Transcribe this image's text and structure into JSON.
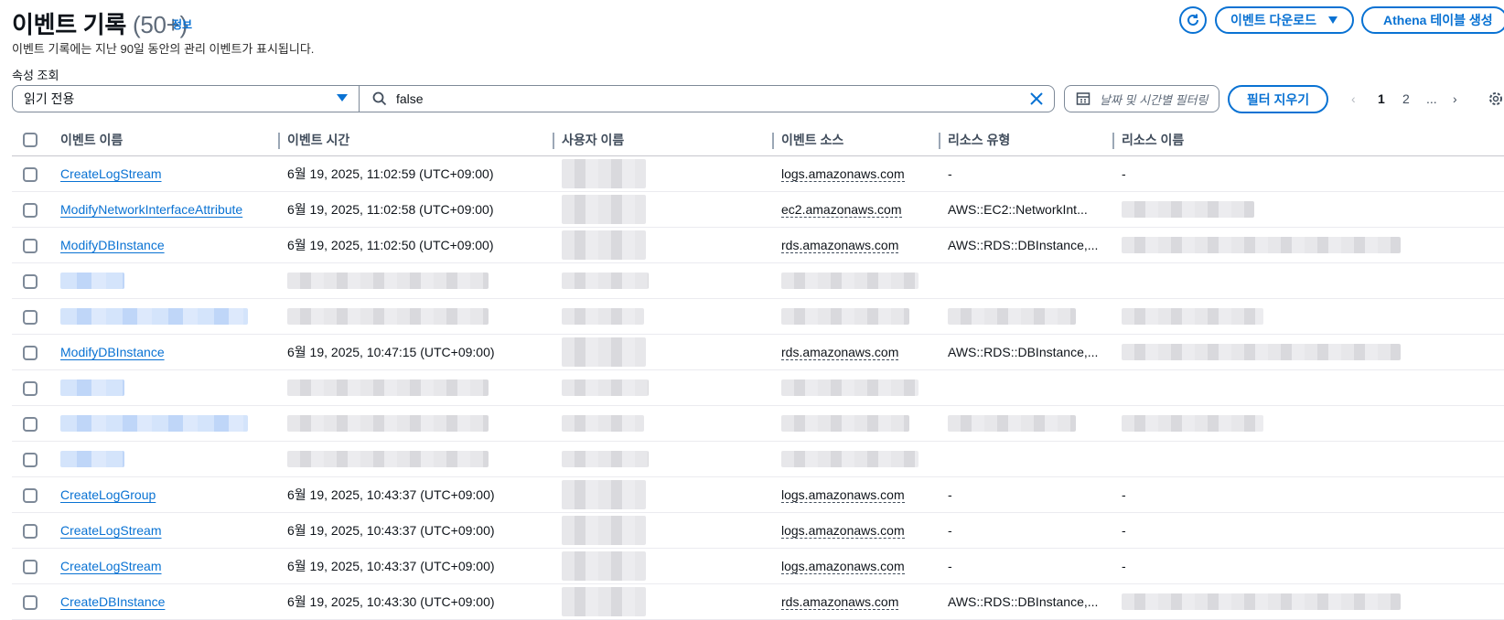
{
  "header": {
    "title": "이벤트 기록",
    "count": "(50+)",
    "info_link": "정보",
    "subtitle": "이벤트 기록에는 지난 90일 동안의 관리 이벤트가 표시됩니다."
  },
  "actions": {
    "refresh_icon": "refresh-icon",
    "download_label": "이벤트 다운로드",
    "athena_label": "Athena 테이블 생성"
  },
  "filters": {
    "property_label": "속성 조회",
    "property_value": "읽기 전용",
    "search_value": "false",
    "date_placeholder": "날짜 및 시간별 필터링",
    "clear_label": "필터 지우기"
  },
  "pagination": {
    "prev": "‹",
    "pages": [
      "1",
      "2"
    ],
    "ellipsis": "...",
    "next": "›",
    "current": "1"
  },
  "table": {
    "columns": [
      "이벤트 이름",
      "이벤트 시간",
      "사용자 이름",
      "이벤트 소스",
      "리소스 유형",
      "리소스 이름"
    ],
    "rows": [
      {
        "event_name": "CreateLogStream",
        "event_time": "6월 19, 2025, 11:02:59 (UTC+09:00)",
        "event_source": "logs.amazonaws.com",
        "resource_type": "-",
        "resource_name": "-",
        "redacted": false
      },
      {
        "event_name": "ModifyNetworkInterfaceAttribute",
        "event_time": "6월 19, 2025, 11:02:58 (UTC+09:00)",
        "event_source": "ec2.amazonaws.com",
        "resource_type": "AWS::EC2::NetworkInt...",
        "resource_name": "",
        "redacted": false
      },
      {
        "event_name": "ModifyDBInstance",
        "event_time": "6월 19, 2025, 11:02:50 (UTC+09:00)",
        "event_source": "rds.amazonaws.com",
        "resource_type": "AWS::RDS::DBInstance,...",
        "resource_name": "",
        "redacted": false
      },
      {
        "event_name": "",
        "event_time": "",
        "event_source": "",
        "resource_type": "",
        "resource_name": "",
        "redacted": true
      },
      {
        "event_name": "",
        "event_time": "",
        "event_source": "",
        "resource_type": "",
        "resource_name": "",
        "redacted": true
      },
      {
        "event_name": "ModifyDBInstance",
        "event_time": "6월 19, 2025, 10:47:15 (UTC+09:00)",
        "event_source": "rds.amazonaws.com",
        "resource_type": "AWS::RDS::DBInstance,...",
        "resource_name": "",
        "redacted": false
      },
      {
        "event_name": "",
        "event_time": "",
        "event_source": "",
        "resource_type": "",
        "resource_name": "",
        "redacted": true
      },
      {
        "event_name": "",
        "event_time": "",
        "event_source": "",
        "resource_type": "",
        "resource_name": "",
        "redacted": true
      },
      {
        "event_name": "",
        "event_time": "",
        "event_source": "",
        "resource_type": "",
        "resource_name": "",
        "redacted": true
      },
      {
        "event_name": "CreateLogGroup",
        "event_time": "6월 19, 2025, 10:43:37 (UTC+09:00)",
        "event_source": "logs.amazonaws.com",
        "resource_type": "-",
        "resource_name": "-",
        "redacted": false
      },
      {
        "event_name": "CreateLogStream",
        "event_time": "6월 19, 2025, 10:43:37 (UTC+09:00)",
        "event_source": "logs.amazonaws.com",
        "resource_type": "-",
        "resource_name": "-",
        "redacted": false
      },
      {
        "event_name": "CreateLogStream",
        "event_time": "6월 19, 2025, 10:43:37 (UTC+09:00)",
        "event_source": "logs.amazonaws.com",
        "resource_type": "-",
        "resource_name": "-",
        "redacted": false
      },
      {
        "event_name": "CreateDBInstance",
        "event_time": "6월 19, 2025, 10:43:30 (UTC+09:00)",
        "event_source": "rds.amazonaws.com",
        "resource_type": "AWS::RDS::DBInstance,...",
        "resource_name": "",
        "redacted": false
      }
    ]
  },
  "colors": {
    "accent": "#0972d3",
    "text": "#0f141a",
    "muted": "#5f6b7a",
    "border": "#7d8998"
  }
}
